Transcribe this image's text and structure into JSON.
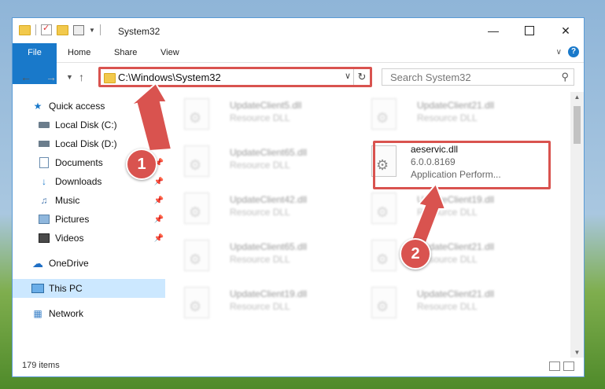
{
  "window": {
    "title": "System32"
  },
  "ribbon": {
    "tabs": [
      "File",
      "Home",
      "Share",
      "View"
    ]
  },
  "address": {
    "path": "C:\\Windows\\System32"
  },
  "search": {
    "placeholder": "Search System32"
  },
  "sidebar": {
    "items": [
      {
        "label": "Quick access",
        "icon": "star-icon"
      },
      {
        "label": "Local Disk (C:)",
        "icon": "drive-icon",
        "pinned": true
      },
      {
        "label": "Local Disk (D:)",
        "icon": "drive-icon",
        "pinned": true
      },
      {
        "label": "Documents",
        "icon": "documents-icon",
        "pinned": true
      },
      {
        "label": "Downloads",
        "icon": "download-icon",
        "pinned": true
      },
      {
        "label": "Music",
        "icon": "music-icon",
        "pinned": true
      },
      {
        "label": "Pictures",
        "icon": "pictures-icon",
        "pinned": true
      },
      {
        "label": "Videos",
        "icon": "videos-icon",
        "pinned": true
      },
      {
        "label": "OneDrive",
        "icon": "cloud-icon"
      },
      {
        "label": "This PC",
        "icon": "computer-icon",
        "selected": true
      },
      {
        "label": "Network",
        "icon": "network-icon"
      }
    ]
  },
  "files": [
    {
      "name": "UpdateClient5.dll",
      "type": "Resource DLL"
    },
    {
      "name": "UpdateClient21.dll",
      "type": "Resource DLL"
    },
    {
      "name": "UpdateClient65.dll",
      "type": "Resource DLL"
    },
    {
      "name": "aeservic.dll",
      "type": "6.0.0.8169",
      "desc": "Application Perform..."
    },
    {
      "name": "UpdateClient42.dll",
      "type": "Resource DLL"
    },
    {
      "name": "UpdateClient19.dll",
      "type": "Resource DLL"
    },
    {
      "name": "UpdateClient65.dll",
      "type": "Resource DLL"
    },
    {
      "name": "UpdateClient21.dll",
      "type": "Resource DLL"
    },
    {
      "name": "UpdateClient19.dll",
      "type": "Resource DLL"
    },
    {
      "name": "UpdateClient21.dll",
      "type": "Resource DLL"
    }
  ],
  "status": {
    "items_count": "179 items"
  },
  "annotations": {
    "badge1": "1",
    "badge2": "2"
  },
  "colors": {
    "accent": "#1979ca",
    "highlight": "#d9534f",
    "selected": "#cce8ff"
  }
}
